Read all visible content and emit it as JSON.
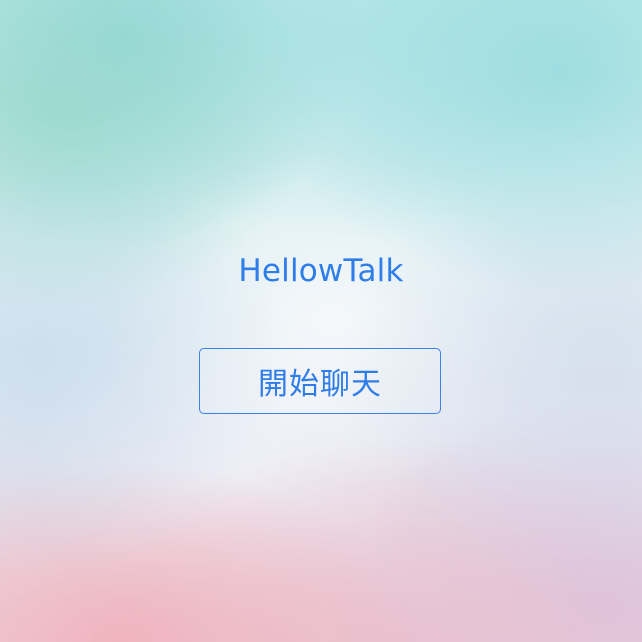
{
  "app": {
    "title": "HellowTalk"
  },
  "actions": {
    "start_chat_label": "開始聊天"
  },
  "colors": {
    "accent": "#2f7de8",
    "button_border": "#3b82e6"
  }
}
